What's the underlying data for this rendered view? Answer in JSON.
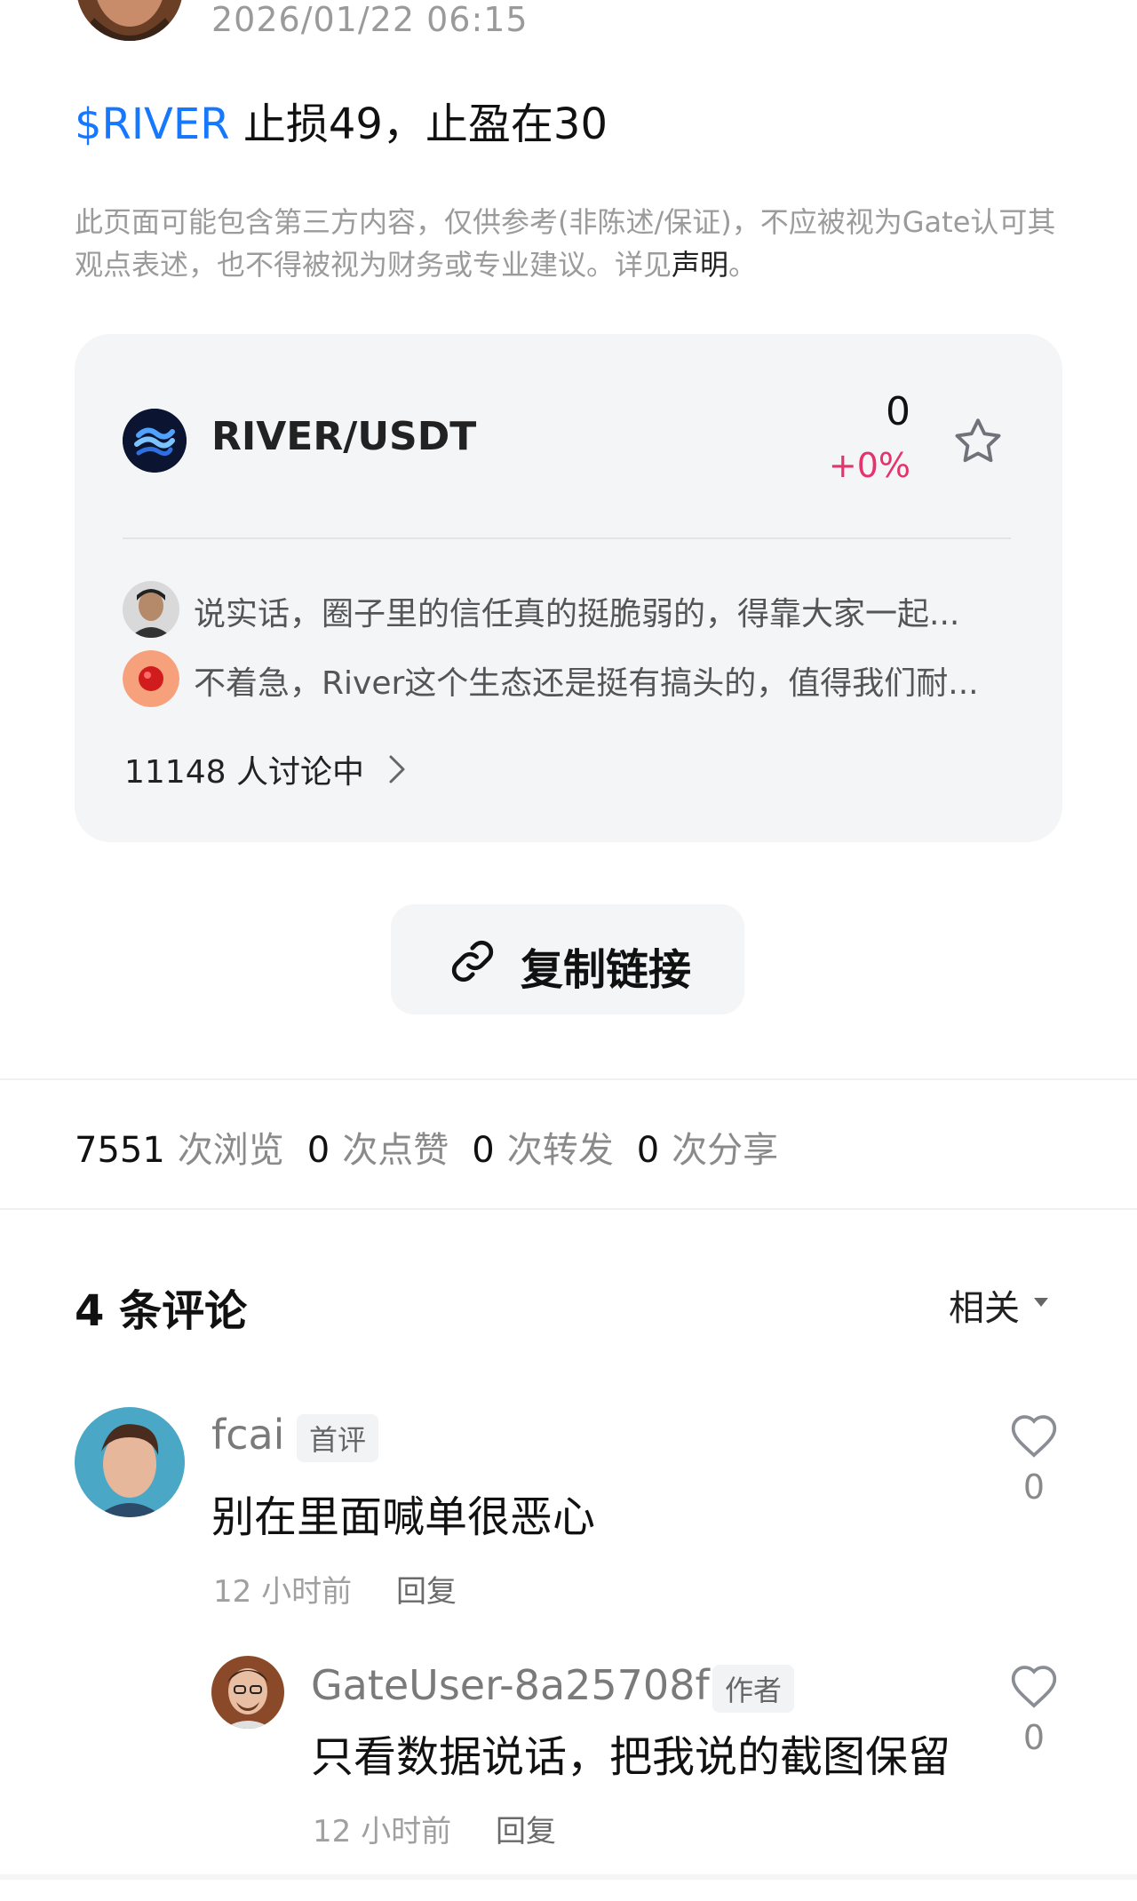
{
  "post": {
    "timestamp": "2026/01/22 06:15",
    "ticker": "$RIVER",
    "text": " 止损49，止盈在30",
    "disclaimer_text": "此页面可能包含第三方内容，仅供参考(非陈述/保证)，不应被视为Gate认可其观点表述，也不得被视为财务或专业建议。详见",
    "disclaimer_link": "声明",
    "disclaimer_end": "。"
  },
  "market_card": {
    "pair": "RIVER/USDT",
    "price": "0",
    "change": "+0%",
    "change_color": "#e5336b",
    "star_icon": "star-outline-icon",
    "feed": [
      {
        "text": "说实话，圈子里的信任真的挺脆弱的，得靠大家一起..."
      },
      {
        "text": "不着急，River这个生态还是挺有搞头的，值得我们耐..."
      }
    ],
    "discuss_label": "11148 人讨论中"
  },
  "copy_link": {
    "label": "复制链接",
    "icon": "link-icon"
  },
  "stats": {
    "views_num": "7551",
    "views_label": "次浏览",
    "likes_num": "0",
    "likes_label": "次点赞",
    "reposts_num": "0",
    "reposts_label": "次转发",
    "shares_num": "0",
    "shares_label": "次分享"
  },
  "comments_header": {
    "title": "4 条评论",
    "sort_label": "相关"
  },
  "comments": [
    {
      "name": "fcai",
      "badge": "首评",
      "body": "别在里面喊单很恶心",
      "time": "12 小时前",
      "reply_label": "回复",
      "likes": "0"
    },
    {
      "name": "GateUser-8a25708f",
      "badge": "作者",
      "body": "只看数据说话，把我说的截图保留",
      "time": "12 小时前",
      "reply_label": "回复",
      "likes": "0"
    }
  ],
  "colors": {
    "accent": "#1677ff",
    "negative_change": "#e5336b",
    "card_bg": "#f4f5f7"
  }
}
